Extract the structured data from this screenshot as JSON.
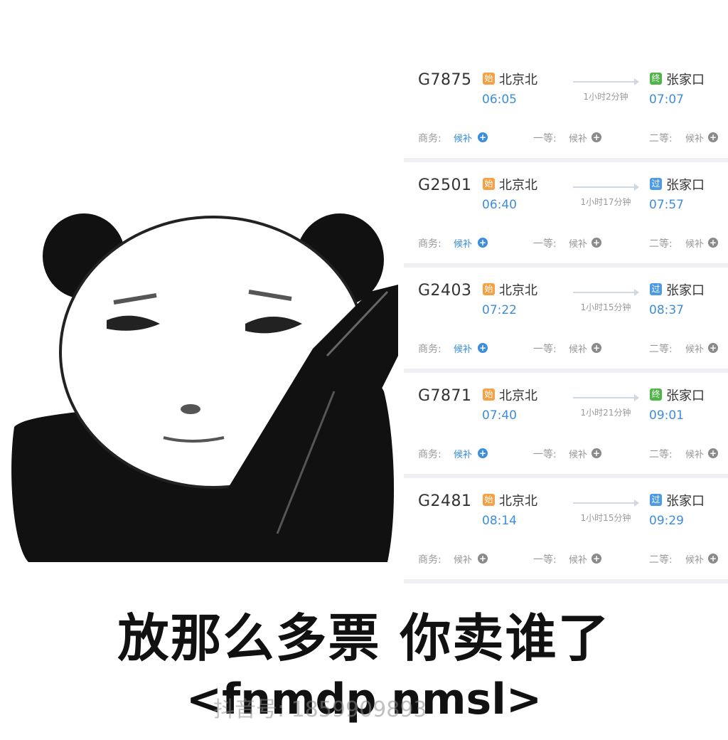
{
  "trains": [
    {
      "number": "G7875",
      "from_badge": "始",
      "from_type": "start",
      "from": "北京北",
      "depart": "06:05",
      "duration": "1小时2分钟",
      "to_badge": "终",
      "to_type": "end",
      "to": "张家口",
      "arrive": "07:07",
      "seats": [
        {
          "label": "商务:",
          "status": "候补",
          "blue": true
        },
        {
          "label": "一等:",
          "status": "候补",
          "blue": false
        },
        {
          "label": "二等:",
          "status": "候补",
          "blue": false
        }
      ]
    },
    {
      "number": "G2501",
      "from_badge": "始",
      "from_type": "start",
      "from": "北京北",
      "depart": "06:40",
      "duration": "1小时17分钟",
      "to_badge": "过",
      "to_type": "pass",
      "to": "张家口",
      "arrive": "07:57",
      "seats": [
        {
          "label": "商务:",
          "status": "候补",
          "blue": true
        },
        {
          "label": "一等:",
          "status": "候补",
          "blue": false
        },
        {
          "label": "二等:",
          "status": "候补",
          "blue": false
        }
      ]
    },
    {
      "number": "G2403",
      "from_badge": "始",
      "from_type": "start",
      "from": "北京北",
      "depart": "07:22",
      "duration": "1小时15分钟",
      "to_badge": "过",
      "to_type": "pass",
      "to": "张家口",
      "arrive": "08:37",
      "seats": [
        {
          "label": "商务:",
          "status": "候补",
          "blue": true
        },
        {
          "label": "一等:",
          "status": "候补",
          "blue": false
        },
        {
          "label": "二等:",
          "status": "候补",
          "blue": false
        }
      ]
    },
    {
      "number": "G7871",
      "from_badge": "始",
      "from_type": "start",
      "from": "北京北",
      "depart": "07:40",
      "duration": "1小时21分钟",
      "to_badge": "终",
      "to_type": "end",
      "to": "张家口",
      "arrive": "09:01",
      "seats": [
        {
          "label": "商务:",
          "status": "候补",
          "blue": true
        },
        {
          "label": "一等:",
          "status": "候补",
          "blue": false
        },
        {
          "label": "二等:",
          "status": "候补",
          "blue": false
        }
      ]
    },
    {
      "number": "G2481",
      "from_badge": "始",
      "from_type": "start",
      "from": "北京北",
      "depart": "08:14",
      "duration": "1小时15分钟",
      "to_badge": "过",
      "to_type": "pass",
      "to": "张家口",
      "arrive": "09:29",
      "seats": [
        {
          "label": "商务:",
          "status": "候补",
          "blue": false
        },
        {
          "label": "一等:",
          "status": "候补",
          "blue": false
        },
        {
          "label": "二等:",
          "status": "候补",
          "blue": false
        }
      ]
    }
  ],
  "caption": "放那么多票  你卖谁了",
  "subcaption": "<fnmdp nmsl>",
  "watermark": "抖音号: 1859909893",
  "colors": {
    "accent_blue": "#3c8edc",
    "start_badge": "#f5a043",
    "end_badge": "#4fb548",
    "pass_badge": "#4d9ae8"
  }
}
